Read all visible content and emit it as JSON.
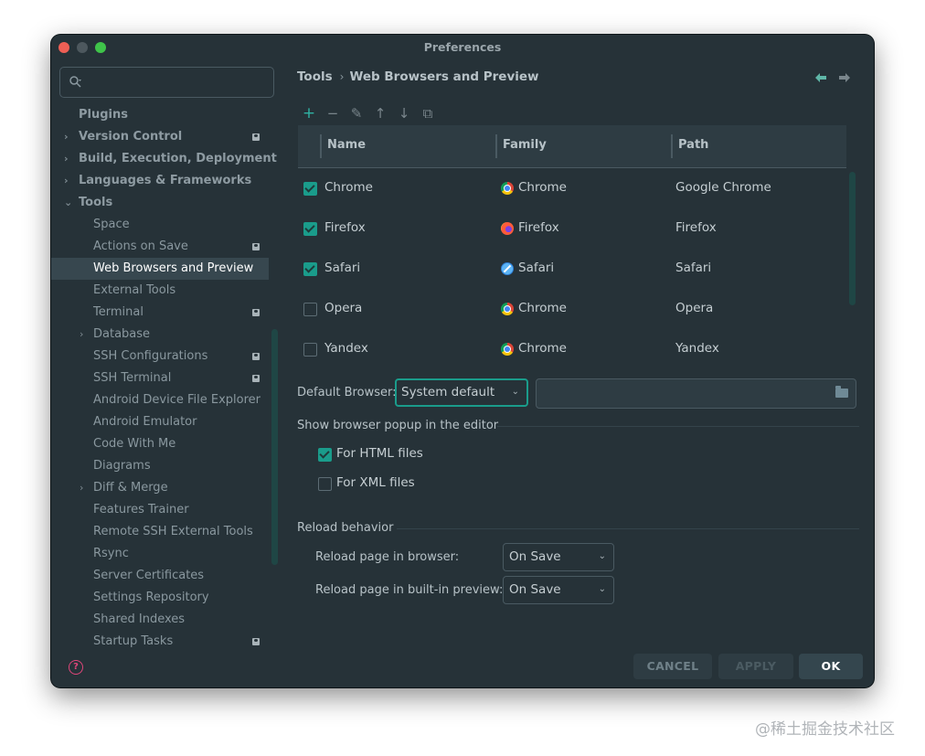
{
  "window": {
    "title": "Preferences"
  },
  "search": {
    "placeholder": ""
  },
  "sidebar": {
    "items": [
      {
        "label": "Plugins",
        "level": 0,
        "chevron": "",
        "badge": false
      },
      {
        "label": "Version Control",
        "level": 0,
        "chevron": "›",
        "badge": true
      },
      {
        "label": "Build, Execution, Deployment",
        "level": 0,
        "chevron": "›",
        "badge": false
      },
      {
        "label": "Languages & Frameworks",
        "level": 0,
        "chevron": "›",
        "badge": false
      },
      {
        "label": "Tools",
        "level": 0,
        "chevron": "⌄",
        "badge": false
      },
      {
        "label": "Space",
        "level": 1,
        "chevron": "",
        "badge": false
      },
      {
        "label": "Actions on Save",
        "level": 1,
        "chevron": "",
        "badge": true
      },
      {
        "label": "Web Browsers and Preview",
        "level": 1,
        "chevron": "",
        "badge": false,
        "selected": true
      },
      {
        "label": "External Tools",
        "level": 1,
        "chevron": "",
        "badge": false
      },
      {
        "label": "Terminal",
        "level": 1,
        "chevron": "",
        "badge": true
      },
      {
        "label": "Database",
        "level": 1,
        "chevron": "›",
        "badge": false
      },
      {
        "label": "SSH Configurations",
        "level": 1,
        "chevron": "",
        "badge": true
      },
      {
        "label": "SSH Terminal",
        "level": 1,
        "chevron": "",
        "badge": true
      },
      {
        "label": "Android Device File Explorer",
        "level": 1,
        "chevron": "",
        "badge": false
      },
      {
        "label": "Android Emulator",
        "level": 1,
        "chevron": "",
        "badge": false
      },
      {
        "label": "Code With Me",
        "level": 1,
        "chevron": "",
        "badge": false
      },
      {
        "label": "Diagrams",
        "level": 1,
        "chevron": "",
        "badge": false
      },
      {
        "label": "Diff & Merge",
        "level": 1,
        "chevron": "›",
        "badge": false
      },
      {
        "label": "Features Trainer",
        "level": 1,
        "chevron": "",
        "badge": false
      },
      {
        "label": "Remote SSH External Tools",
        "level": 1,
        "chevron": "",
        "badge": false
      },
      {
        "label": "Rsync",
        "level": 1,
        "chevron": "",
        "badge": false
      },
      {
        "label": "Server Certificates",
        "level": 1,
        "chevron": "",
        "badge": false
      },
      {
        "label": "Settings Repository",
        "level": 1,
        "chevron": "",
        "badge": false
      },
      {
        "label": "Shared Indexes",
        "level": 1,
        "chevron": "",
        "badge": false
      },
      {
        "label": "Startup Tasks",
        "level": 1,
        "chevron": "",
        "badge": true
      }
    ]
  },
  "breadcrumb": {
    "parent": "Tools",
    "separator": "›",
    "current": "Web Browsers and Preview"
  },
  "nav": {
    "back": "🡄",
    "forward": "🡆"
  },
  "toolbar": {
    "add": "+",
    "remove": "−",
    "edit": "✎",
    "up": "↑",
    "down": "↓",
    "copy": "⧉"
  },
  "table": {
    "columns": [
      "Name",
      "Family",
      "Path"
    ],
    "rows": [
      {
        "checked": true,
        "name": "Chrome",
        "family": "Chrome",
        "family_icon": "chrome",
        "path": "Google Chrome"
      },
      {
        "checked": true,
        "name": "Firefox",
        "family": "Firefox",
        "family_icon": "firefox",
        "path": "Firefox"
      },
      {
        "checked": true,
        "name": "Safari",
        "family": "Safari",
        "family_icon": "safari",
        "path": "Safari"
      },
      {
        "checked": false,
        "name": "Opera",
        "family": "Chrome",
        "family_icon": "chrome",
        "path": "Opera"
      },
      {
        "checked": false,
        "name": "Yandex",
        "family": "Chrome",
        "family_icon": "chrome",
        "path": "Yandex"
      }
    ]
  },
  "default_browser": {
    "label": "Default Browser:",
    "value": "System default",
    "path_value": ""
  },
  "popup": {
    "title": "Show browser popup in the editor",
    "html": {
      "label": "For HTML files",
      "checked": true
    },
    "xml": {
      "label": "For XML files",
      "checked": false
    }
  },
  "reload": {
    "title": "Reload behavior",
    "browser": {
      "label": "Reload page in browser:",
      "value": "On Save"
    },
    "preview": {
      "label": "Reload page in built-in preview:",
      "value": "On Save"
    }
  },
  "buttons": {
    "cancel": "CANCEL",
    "apply": "APPLY",
    "ok": "OK"
  },
  "help": {
    "glyph": "?"
  },
  "watermark": "@稀土掘金技术社区",
  "colors": {
    "accent": "#1a9c8b",
    "background": "#263238",
    "selection": "#37474f"
  }
}
